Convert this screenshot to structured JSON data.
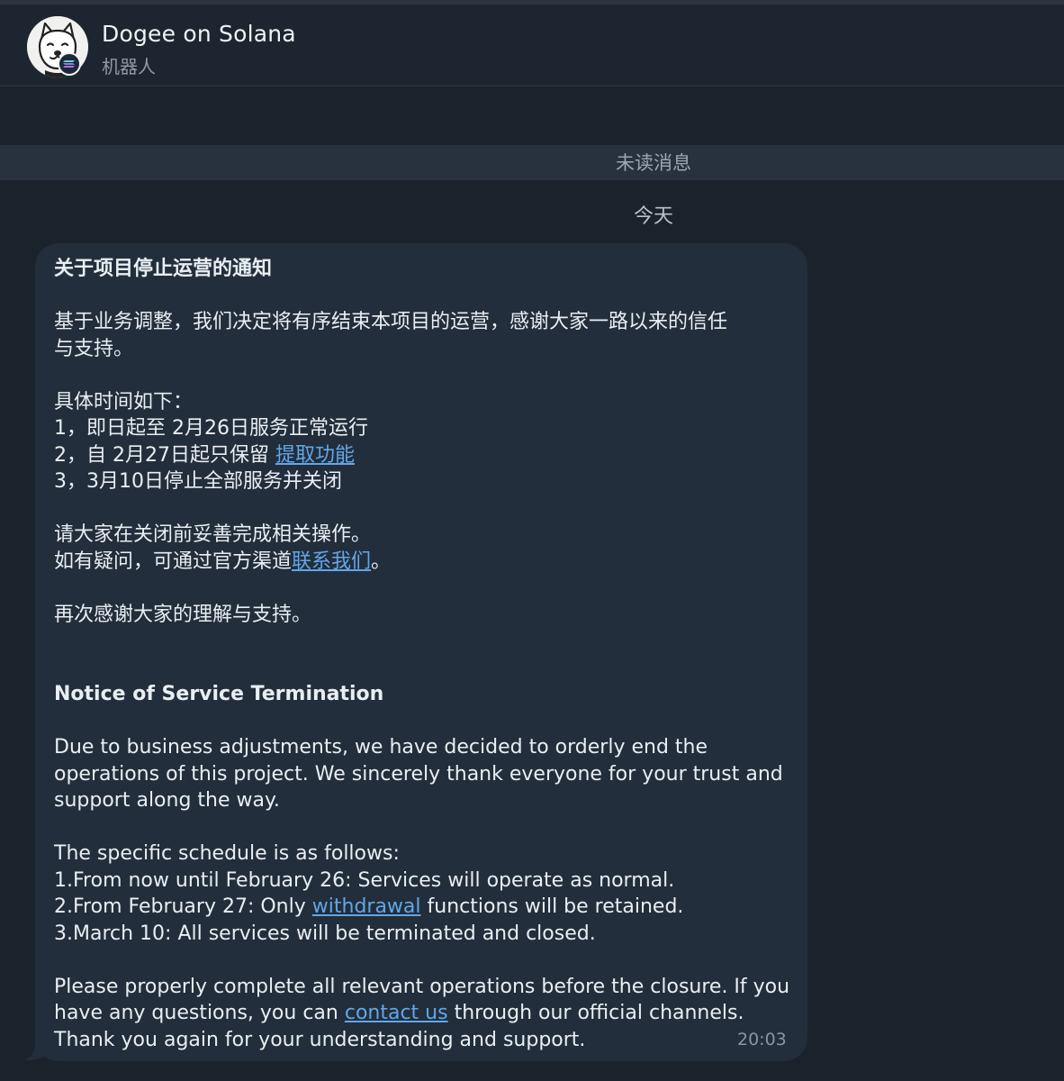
{
  "header": {
    "title": "Dogee on Solana",
    "subtitle": "机器人",
    "avatar_icon": "shiba-dog-avatar-icon",
    "badge_icon": "solana-logo-icon"
  },
  "unread_label": "未读消息",
  "date_label": "今天",
  "message": {
    "zh_title": "关于项目停止运营的通知",
    "zh_intro_1": "基于业务调整，我们决定将有序结束本项目的运营，感谢大家一路以来的信任",
    "zh_intro_2": "与支持。",
    "zh_schedule_heading": "具体时间如下：",
    "zh_item_1": "1，即日起至 2月26日服务正常运行",
    "zh_item_2_prefix": "2，自 2月27日起只保留 ",
    "zh_item_2_link": "提取功能",
    "zh_item_3": "3，3月10日停止全部服务并关闭",
    "zh_closing_1": "请大家在关闭前妥善完成相关操作。",
    "zh_closing_2_prefix": "如有疑问，可通过官方渠道",
    "zh_closing_2_link": "联系我们",
    "zh_closing_2_suffix": "。",
    "zh_thanks": "再次感谢大家的理解与支持。",
    "en_title": "Notice of Service Termination",
    "en_intro_1": "Due to business adjustments, we have decided to orderly end the",
    "en_intro_2": "operations of this project. We sincerely thank everyone for your trust and",
    "en_intro_3": "support along the way.",
    "en_schedule_heading": "The specific schedule is as follows:",
    "en_item_1": "1.From now until February 26: Services will operate as normal.",
    "en_item_2_prefix": "2.From February 27: Only ",
    "en_item_2_link": "withdrawal",
    "en_item_2_suffix": " functions will be retained.",
    "en_item_3": "3.March 10: All services will be terminated and closed.",
    "en_closing_1": "Please properly complete all relevant operations before the closure. If you",
    "en_closing_2_prefix": "have any questions, you can ",
    "en_closing_2_link": "contact us",
    "en_closing_2_suffix": " through our official channels.",
    "en_thanks": "Thank you again for your understanding and support.",
    "time": "20:03"
  },
  "colors": {
    "background": "#1a222c",
    "header": "#1d2630",
    "bubble": "#222e3b",
    "link": "#62a6e8",
    "unread_bar": "#27323e"
  }
}
